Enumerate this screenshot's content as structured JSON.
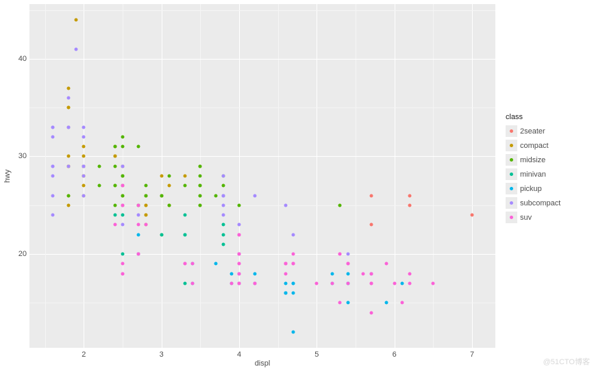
{
  "chart_data": {
    "type": "scatter",
    "xlabel": "displ",
    "ylabel": "hwy",
    "xlim": [
      1.3,
      7.3
    ],
    "ylim": [
      10.4,
      45.6
    ],
    "x_ticks": [
      2,
      3,
      4,
      5,
      6,
      7
    ],
    "y_ticks": [
      20,
      30,
      40
    ],
    "legend_title": "class",
    "series": [
      {
        "name": "2seater",
        "color": "#F8766D",
        "points": [
          [
            5.7,
            26
          ],
          [
            5.7,
            23
          ],
          [
            6.2,
            26
          ],
          [
            6.2,
            25
          ],
          [
            7.0,
            24
          ]
        ]
      },
      {
        "name": "compact",
        "color": "#C49A00",
        "points": [
          [
            1.8,
            29
          ],
          [
            1.8,
            29
          ],
          [
            2.0,
            31
          ],
          [
            2.0,
            30
          ],
          [
            2.8,
            26
          ],
          [
            2.8,
            26
          ],
          [
            3.1,
            27
          ],
          [
            1.8,
            26
          ],
          [
            1.8,
            25
          ],
          [
            2.0,
            28
          ],
          [
            2.0,
            27
          ],
          [
            2.8,
            25
          ],
          [
            2.8,
            25
          ],
          [
            3.1,
            25
          ],
          [
            3.1,
            25
          ],
          [
            2.4,
            30
          ],
          [
            2.4,
            30
          ],
          [
            2.5,
            26
          ],
          [
            2.5,
            27
          ],
          [
            1.8,
            30
          ],
          [
            1.8,
            33
          ],
          [
            1.8,
            35
          ],
          [
            1.8,
            37
          ],
          [
            1.8,
            35
          ],
          [
            2.0,
            29
          ],
          [
            2.0,
            26
          ],
          [
            2.0,
            29
          ],
          [
            2.0,
            29
          ],
          [
            2.8,
            24
          ],
          [
            1.9,
            44
          ],
          [
            2.0,
            29
          ],
          [
            2.0,
            29
          ],
          [
            2.0,
            28
          ],
          [
            2.0,
            29
          ],
          [
            2.5,
            29
          ],
          [
            2.5,
            29
          ],
          [
            2.8,
            23
          ],
          [
            2.8,
            24
          ],
          [
            1.8,
            29
          ],
          [
            1.8,
            29
          ],
          [
            2.0,
            28
          ],
          [
            2.0,
            29
          ],
          [
            2.4,
            31
          ],
          [
            2.4,
            30
          ],
          [
            3.0,
            26
          ],
          [
            3.0,
            28
          ],
          [
            3.3,
            28
          ]
        ]
      },
      {
        "name": "midsize",
        "color": "#53B400",
        "points": [
          [
            2.8,
            26
          ],
          [
            2.8,
            27
          ],
          [
            2.8,
            26
          ],
          [
            3.1,
            25
          ],
          [
            2.4,
            27
          ],
          [
            2.4,
            25
          ],
          [
            2.5,
            26
          ],
          [
            2.5,
            27
          ],
          [
            2.5,
            26
          ],
          [
            2.5,
            25
          ],
          [
            2.5,
            28
          ],
          [
            2.7,
            25
          ],
          [
            2.7,
            31
          ],
          [
            2.7,
            25
          ],
          [
            3.0,
            26
          ],
          [
            3.7,
            26
          ],
          [
            4.0,
            25
          ],
          [
            3.5,
            29
          ],
          [
            3.5,
            25
          ],
          [
            3.0,
            26
          ],
          [
            3.0,
            22
          ],
          [
            3.5,
            27
          ],
          [
            3.5,
            26
          ],
          [
            3.5,
            26
          ],
          [
            3.5,
            28
          ],
          [
            3.5,
            25
          ],
          [
            3.5,
            29
          ],
          [
            3.8,
            26
          ],
          [
            3.8,
            28
          ],
          [
            3.8,
            27
          ],
          [
            5.3,
            25
          ],
          [
            2.2,
            27
          ],
          [
            2.2,
            29
          ],
          [
            2.4,
            31
          ],
          [
            2.4,
            31
          ],
          [
            3.0,
            26
          ],
          [
            3.3,
            27
          ],
          [
            2.5,
            28
          ],
          [
            2.5,
            28
          ],
          [
            3.5,
            27
          ],
          [
            2.4,
            29
          ],
          [
            2.4,
            27
          ],
          [
            2.5,
            31
          ],
          [
            2.5,
            32
          ],
          [
            3.5,
            27
          ],
          [
            3.1,
            28
          ],
          [
            1.8,
            26
          ]
        ]
      },
      {
        "name": "minivan",
        "color": "#00C094",
        "points": [
          [
            2.4,
            24
          ],
          [
            3.0,
            22
          ],
          [
            3.3,
            22
          ],
          [
            3.3,
            24
          ],
          [
            3.3,
            22
          ],
          [
            3.3,
            22
          ],
          [
            3.3,
            17
          ],
          [
            3.8,
            22
          ],
          [
            3.8,
            21
          ],
          [
            3.8,
            23
          ],
          [
            2.5,
            20
          ],
          [
            2.5,
            24
          ]
        ]
      },
      {
        "name": "pickup",
        "color": "#00B6EB",
        "points": [
          [
            3.7,
            19
          ],
          [
            3.9,
            18
          ],
          [
            3.9,
            17
          ],
          [
            4.7,
            12
          ],
          [
            4.7,
            17
          ],
          [
            4.7,
            16
          ],
          [
            5.2,
            18
          ],
          [
            5.2,
            17
          ],
          [
            5.9,
            15
          ],
          [
            4.2,
            18
          ],
          [
            4.2,
            17
          ],
          [
            4.6,
            16
          ],
          [
            4.6,
            16
          ],
          [
            5.4,
            17
          ],
          [
            5.4,
            15
          ],
          [
            4.0,
            20
          ],
          [
            4.0,
            17
          ],
          [
            4.0,
            17
          ],
          [
            4.6,
            16
          ],
          [
            4.6,
            16
          ],
          [
            4.6,
            17
          ],
          [
            5.4,
            17
          ],
          [
            5.4,
            18
          ],
          [
            2.7,
            20
          ],
          [
            2.7,
            20
          ],
          [
            2.7,
            22
          ],
          [
            3.4,
            17
          ],
          [
            3.4,
            19
          ],
          [
            4.0,
            18
          ],
          [
            4.0,
            20
          ],
          [
            4.7,
            17
          ],
          [
            5.7,
            18
          ],
          [
            6.1,
            17
          ]
        ]
      },
      {
        "name": "subcompact",
        "color": "#A58AFF",
        "points": [
          [
            3.8,
            26
          ],
          [
            3.8,
            25
          ],
          [
            3.8,
            26
          ],
          [
            3.8,
            24
          ],
          [
            3.8,
            26
          ],
          [
            4.0,
            23
          ],
          [
            4.2,
            26
          ],
          [
            4.6,
            25
          ],
          [
            5.4,
            20
          ],
          [
            1.6,
            33
          ],
          [
            1.6,
            32
          ],
          [
            1.6,
            29
          ],
          [
            1.8,
            33
          ],
          [
            1.8,
            36
          ],
          [
            1.8,
            33
          ],
          [
            1.8,
            29
          ],
          [
            2.0,
            33
          ],
          [
            2.0,
            32
          ],
          [
            1.6,
            33
          ],
          [
            1.6,
            29
          ],
          [
            1.6,
            28
          ],
          [
            2.0,
            26
          ],
          [
            2.7,
            24
          ],
          [
            1.6,
            24
          ],
          [
            1.6,
            26
          ],
          [
            2.5,
            23
          ],
          [
            3.8,
            28
          ],
          [
            2.0,
            29
          ],
          [
            2.0,
            29
          ],
          [
            2.0,
            28
          ],
          [
            2.0,
            29
          ],
          [
            1.9,
            41
          ],
          [
            2.5,
            29
          ],
          [
            2.5,
            29
          ],
          [
            4.7,
            22
          ]
        ]
      },
      {
        "name": "suv",
        "color": "#FB61D7",
        "points": [
          [
            5.3,
            20
          ],
          [
            5.3,
            15
          ],
          [
            5.3,
            20
          ],
          [
            5.7,
            17
          ],
          [
            6.0,
            17
          ],
          [
            5.7,
            18
          ],
          [
            5.7,
            17
          ],
          [
            6.2,
            18
          ],
          [
            6.2,
            17
          ],
          [
            6.5,
            17
          ],
          [
            3.9,
            17
          ],
          [
            4.7,
            19
          ],
          [
            4.7,
            19
          ],
          [
            4.7,
            19
          ],
          [
            5.2,
            17
          ],
          [
            5.7,
            17
          ],
          [
            5.9,
            19
          ],
          [
            4.0,
            19
          ],
          [
            4.0,
            19
          ],
          [
            4.0,
            17
          ],
          [
            4.0,
            17
          ],
          [
            4.6,
            19
          ],
          [
            5.0,
            17
          ],
          [
            4.2,
            17
          ],
          [
            4.2,
            17
          ],
          [
            4.6,
            19
          ],
          [
            4.6,
            19
          ],
          [
            4.6,
            19
          ],
          [
            5.4,
            19
          ],
          [
            5.4,
            19
          ],
          [
            4.0,
            20
          ],
          [
            4.0,
            18
          ],
          [
            4.0,
            20
          ],
          [
            4.0,
            17
          ],
          [
            4.6,
            19
          ],
          [
            4.6,
            19
          ],
          [
            4.6,
            18
          ],
          [
            5.4,
            17
          ],
          [
            5.4,
            19
          ],
          [
            3.3,
            19
          ],
          [
            3.3,
            19
          ],
          [
            4.0,
            18
          ],
          [
            5.6,
            18
          ],
          [
            2.5,
            18
          ],
          [
            2.5,
            18
          ],
          [
            2.5,
            19
          ],
          [
            4.0,
            20
          ],
          [
            4.7,
            19
          ],
          [
            5.7,
            14
          ],
          [
            2.7,
            20
          ],
          [
            2.7,
            20
          ],
          [
            3.4,
            17
          ],
          [
            3.4,
            19
          ],
          [
            4.7,
            20
          ],
          [
            5.7,
            18
          ],
          [
            6.1,
            15
          ],
          [
            4.0,
            22
          ],
          [
            4.0,
            22
          ],
          [
            4.0,
            22
          ],
          [
            4.0,
            22
          ],
          [
            2.5,
            25
          ],
          [
            2.7,
            23
          ],
          [
            2.7,
            25
          ],
          [
            2.5,
            27
          ],
          [
            2.5,
            25
          ],
          [
            2.5,
            27
          ],
          [
            2.8,
            23
          ],
          [
            2.4,
            23
          ]
        ]
      }
    ]
  },
  "watermark": "@51CTO博客"
}
